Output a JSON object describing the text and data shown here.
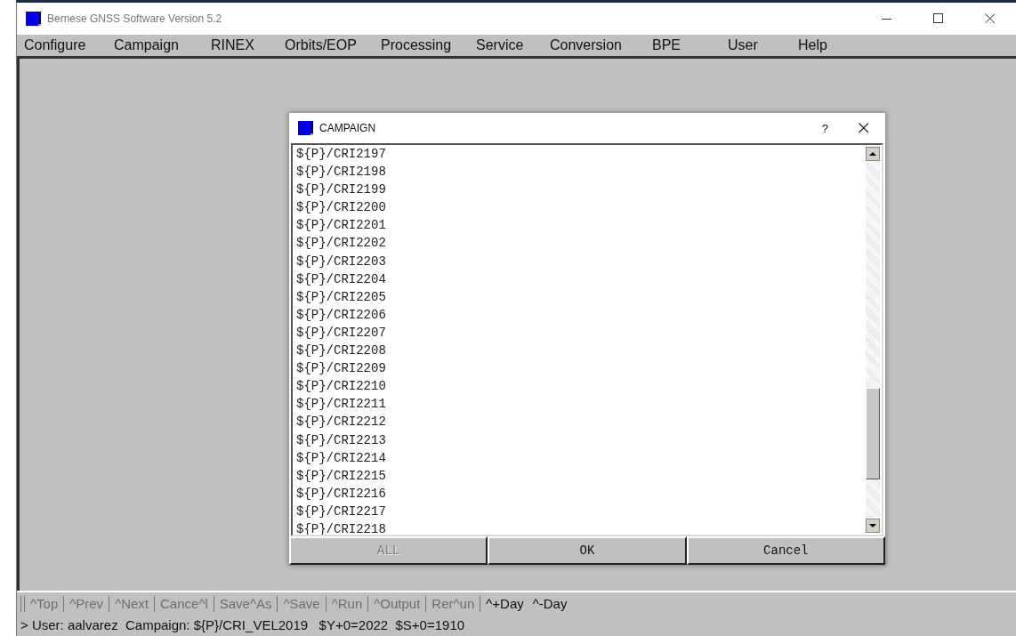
{
  "window": {
    "title": "Bernese GNSS Software Version 5.2"
  },
  "menu": [
    "Configure",
    "Campaign",
    "RINEX",
    "Orbits/EOP",
    "Processing",
    "Service",
    "Conversion",
    "BPE",
    "User",
    "Help"
  ],
  "dialog": {
    "title": "CAMPAIGN",
    "help": "?",
    "items": [
      "${P}/CRI2197",
      "${P}/CRI2198",
      "${P}/CRI2199",
      "${P}/CRI2200",
      "${P}/CRI2201",
      "${P}/CRI2202",
      "${P}/CRI2203",
      "${P}/CRI2204",
      "${P}/CRI2205",
      "${P}/CRI2206",
      "${P}/CRI2207",
      "${P}/CRI2208",
      "${P}/CRI2209",
      "${P}/CRI2210",
      "${P}/CRI2211",
      "${P}/CRI2212",
      "${P}/CRI2213",
      "${P}/CRI2214",
      "${P}/CRI2215",
      "${P}/CRI2216",
      "${P}/CRI2217",
      "${P}/CRI2218"
    ],
    "buttons": [
      {
        "label": "ALL",
        "disabled": true
      },
      {
        "label": "OK",
        "disabled": false
      },
      {
        "label": "Cancel",
        "disabled": false
      }
    ]
  },
  "toolbar": [
    {
      "label": "^Top",
      "disabled": true
    },
    {
      "label": "^Prev",
      "disabled": true
    },
    {
      "label": "^Next",
      "disabled": true
    },
    {
      "label": "Cance^l",
      "disabled": true
    },
    {
      "label": "Save^As",
      "disabled": true
    },
    {
      "label": "^Save",
      "disabled": true
    },
    {
      "label": "^Run",
      "disabled": true
    },
    {
      "label": "^Output",
      "disabled": true
    },
    {
      "label": "Rer^un",
      "disabled": true
    },
    {
      "label": "^+Day",
      "disabled": false
    },
    {
      "label": "^-Day",
      "disabled": false
    }
  ],
  "status_bar": "> User: aalvarez  Campaign: ${P}/CRI_VEL2019   $Y+0=2022  $S+0=1910"
}
